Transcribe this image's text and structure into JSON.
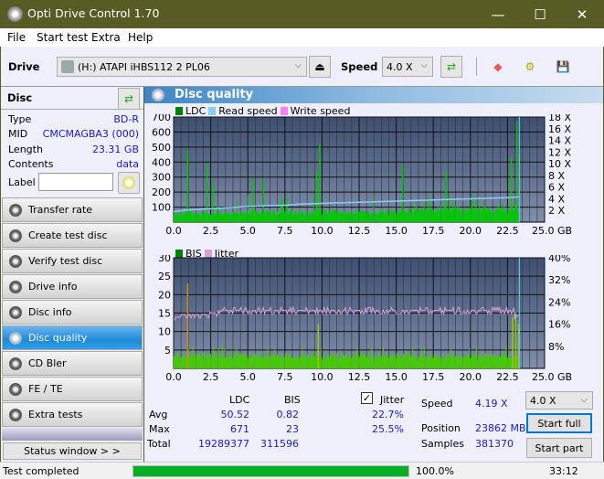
{
  "window": {
    "title": "Opti Drive Control 1.70",
    "minimize": "—",
    "maximize": "☐",
    "close": "✕"
  },
  "menu": [
    "File",
    "Start test",
    "Extra",
    "Help"
  ],
  "toolbar": {
    "drive_label": "Drive",
    "drive_value": "(H:)  ATAPI iHBS112  2 PL06",
    "speed_label": "Speed",
    "speed_value": "4.0 X"
  },
  "disc": {
    "header": "Disc",
    "type_k": "Type",
    "type_v": "BD-R",
    "mid_k": "MID",
    "mid_v": "CMCMAGBA3 (000)",
    "length_k": "Length",
    "length_v": "23.31 GB",
    "contents_k": "Contents",
    "contents_v": "data",
    "label_k": "Label",
    "label_v": ""
  },
  "nav": [
    "Transfer rate",
    "Create test disc",
    "Verify test disc",
    "Drive info",
    "Disc info",
    "Disc quality",
    "CD Bler",
    "FE / TE",
    "Extra tests"
  ],
  "status_window": "Status window > >",
  "panel": {
    "title": "Disc quality"
  },
  "chart_data": [
    {
      "type": "bar",
      "title": "LDC / Read speed",
      "legend": [
        "LDC",
        "Read speed",
        "Write speed"
      ],
      "legend_colors": [
        "#008000",
        "#87cefa",
        "#ff80ff"
      ],
      "x_ticks": [
        "0.0",
        "2.5",
        "5.0",
        "7.5",
        "10.0",
        "12.5",
        "15.0",
        "17.5",
        "20.0",
        "22.5",
        "25.0 GB"
      ],
      "y_left_ticks": [
        "700",
        "600",
        "500",
        "400",
        "300",
        "200",
        "100"
      ],
      "y_right_ticks": [
        "18 X",
        "16 X",
        "14 X",
        "12 X",
        "10 X",
        "8 X",
        "6 X",
        "4 X",
        "2 X"
      ],
      "xlim": [
        0,
        25
      ],
      "ylim": [
        0,
        700
      ],
      "y2lim": [
        0,
        18
      ],
      "ldc_baseline": [
        [
          0,
          70
        ],
        [
          5,
          75
        ],
        [
          10,
          80
        ],
        [
          15,
          95
        ],
        [
          20,
          100
        ],
        [
          22.5,
          110
        ],
        [
          23.3,
          130
        ]
      ],
      "ldc_spikes": [
        [
          0.9,
          480
        ],
        [
          2.2,
          390
        ],
        [
          2.6,
          260
        ],
        [
          5.3,
          290
        ],
        [
          6.0,
          285
        ],
        [
          9.6,
          335
        ],
        [
          9.8,
          520
        ],
        [
          15.4,
          380
        ],
        [
          18.3,
          340
        ],
        [
          22.7,
          430
        ],
        [
          23.1,
          671
        ]
      ],
      "read_speed": [
        [
          0,
          1.8
        ],
        [
          1,
          2.1
        ],
        [
          2.5,
          2.3
        ],
        [
          4,
          2.5
        ],
        [
          5,
          2.7
        ],
        [
          7.5,
          2.9
        ],
        [
          8.5,
          3.1
        ],
        [
          10,
          3.2
        ],
        [
          11,
          3.3
        ],
        [
          12.5,
          3.4
        ],
        [
          15,
          3.6
        ],
        [
          17.5,
          3.8
        ],
        [
          20,
          4.0
        ],
        [
          22.5,
          4.2
        ],
        [
          23.3,
          4.3
        ]
      ],
      "end_marker_gb": 23.3
    },
    {
      "type": "bar",
      "title": "BIS / Jitter",
      "legend": [
        "BIS",
        "Jitter"
      ],
      "legend_colors": [
        "#008000",
        "#d8a0d8"
      ],
      "x_ticks": [
        "0.0",
        "2.5",
        "5.0",
        "7.5",
        "10.0",
        "12.5",
        "15.0",
        "17.5",
        "20.0",
        "22.5",
        "25.0 GB"
      ],
      "y_left_ticks": [
        "30",
        "25",
        "20",
        "15",
        "10",
        "5"
      ],
      "y_right_ticks": [
        "40%",
        "32%",
        "24%",
        "16%",
        "8%"
      ],
      "xlim": [
        0,
        25
      ],
      "ylim": [
        0,
        30
      ],
      "y2lim": [
        0,
        40
      ],
      "bis_baseline": 3.5,
      "bis_spikes": [
        [
          0.9,
          23
        ],
        [
          9.7,
          12
        ],
        [
          22.8,
          14
        ],
        [
          23.0,
          15
        ],
        [
          23.2,
          12
        ]
      ],
      "jitter": [
        [
          0,
          18.5
        ],
        [
          0.5,
          19.5
        ],
        [
          1.5,
          19.5
        ],
        [
          2.5,
          20
        ],
        [
          3,
          21
        ],
        [
          5,
          21
        ],
        [
          10,
          21
        ],
        [
          15,
          21
        ],
        [
          20,
          21
        ],
        [
          23,
          19
        ]
      ],
      "end_marker_gb": 23.3
    }
  ],
  "stats": {
    "col_ldc": "LDC",
    "col_bis": "BIS",
    "jitter_label": "Jitter",
    "jitter_checked": true,
    "avg_label": "Avg",
    "max_label": "Max",
    "total_label": "Total",
    "avg_ldc": "50.52",
    "avg_bis": "0.82",
    "avg_jitter": "22.7%",
    "max_ldc": "671",
    "max_bis": "23",
    "max_jitter": "25.5%",
    "total_ldc": "19289377",
    "total_bis": "311596",
    "speed_label": "Speed",
    "speed_value": "4.19 X",
    "speed_select": "4.0 X",
    "position_label": "Position",
    "position_value": "23862 MB",
    "samples_label": "Samples",
    "samples_value": "381370",
    "start_full": "Start full",
    "start_part": "Start part"
  },
  "statusbar": {
    "text": "Test completed",
    "progress": 100.0,
    "progress_text": "100.0%",
    "time": "33:12"
  }
}
